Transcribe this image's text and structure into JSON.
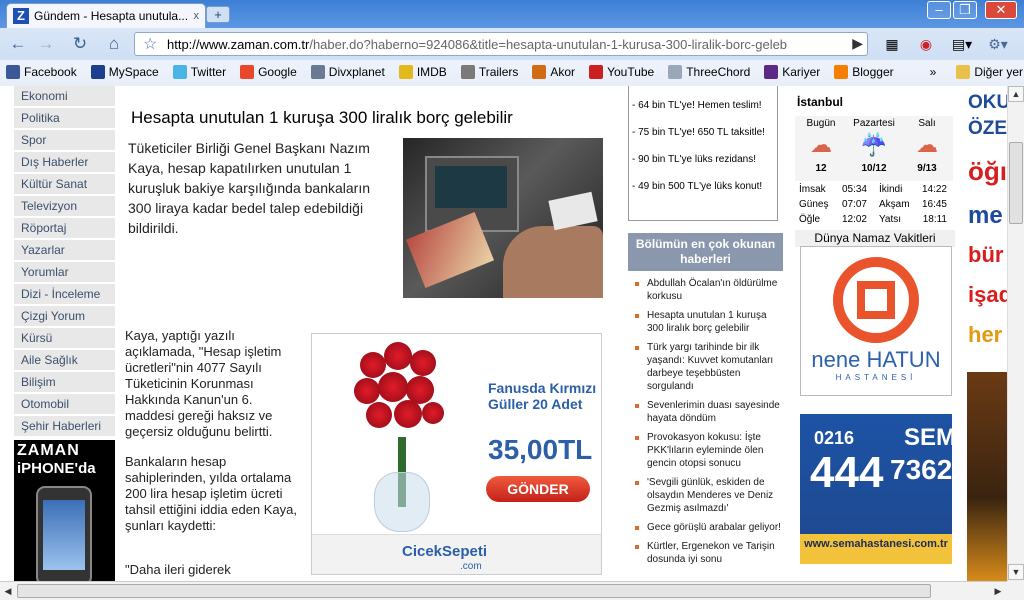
{
  "browser": {
    "tab_title": "Gündem - Hesapta unutula...",
    "tab_close": "x",
    "new_tab": "+",
    "window_controls": [
      "–",
      "❐",
      "✕"
    ],
    "url_host": "http://www.zaman.com.tr",
    "url_path": "/haber.do?haberno=924086&title=hesapta-unutulan-1-kurusa-300-liralik-borc-geleb",
    "bookmarks": [
      {
        "label": "Facebook",
        "icon": "facebook-icon",
        "color": "#3b5998"
      },
      {
        "label": "MySpace",
        "icon": "myspace-icon",
        "color": "#1c3f8f"
      },
      {
        "label": "Twitter",
        "icon": "twitter-icon",
        "color": "#4ab3e8"
      },
      {
        "label": "Google",
        "icon": "google-icon",
        "color": "#e8472b"
      },
      {
        "label": "Divxplanet",
        "icon": "divxplanet-icon",
        "color": "#6a7a93"
      },
      {
        "label": "IMDB",
        "icon": "imdb-icon",
        "color": "#e3b81f"
      },
      {
        "label": "Trailers",
        "icon": "trailers-icon",
        "color": "#7a7a7a"
      },
      {
        "label": "Akor",
        "icon": "akor-icon",
        "color": "#d26b11"
      },
      {
        "label": "YouTube",
        "icon": "youtube-icon",
        "color": "#cc1f1f"
      },
      {
        "label": "ThreeChord",
        "icon": "page-icon",
        "color": "#9aa7b8"
      },
      {
        "label": "Kariyer",
        "icon": "kariyer-icon",
        "color": "#5b2a86"
      },
      {
        "label": "Blogger",
        "icon": "blogger-icon",
        "color": "#f57d00"
      }
    ],
    "bookmarks_overflow": "»",
    "other_bookmarks": "Diğer yer imleri"
  },
  "leftnav": {
    "items": [
      "Ekonomi",
      "Politika",
      "Spor",
      "Dış Haberler",
      "Kültür Sanat",
      "Televizyon",
      "Röportaj",
      "Yazarlar",
      "Yorumlar",
      "Dizi - İnceleme",
      "Çizgi Yorum",
      "Kürsü",
      "Aile Sağlık",
      "Bilişim",
      "Otomobil",
      "Şehir Haberleri"
    ],
    "zaman_ad_logo": "ZAMAN",
    "zaman_ad_text": "iPHONE'da"
  },
  "article": {
    "title": "Hesapta unutulan 1 kuruşa 300 liralık borç gelebilir",
    "lead": "Tüketiciler Birliği Genel Başkanı Nazım Kaya, hesap kapatılırken unutulan 1 kuruşluk bakiye karşılığında bankaların 300 liraya kadar bedel talep edebildiği bildirildi.",
    "para1": "Kaya, yaptığı yazılı açıklamada, \"Hesap işletim ücretleri\"nin 4077 Sayılı Tüketicinin Korunması Hakkında Kanun'un 6. maddesi gereği haksız ve geçersiz olduğunu belirtti.",
    "para2": "Bankaların hesap sahiplerinden, yılda ortalama 200 lira hesap işletim ücreti tahsil ettiğini iddia eden Kaya, şunları kaydetti:",
    "para3": "\"Daha ileri giderek"
  },
  "flower_ad": {
    "headline": "Fanusda Kırmızı Güller 20 Adet",
    "price": "35,00TL",
    "button": "GÖNDER",
    "brand": "CicekSepeti",
    "brand_suffix": ".com"
  },
  "promo": {
    "items": [
      "- 64 bin TL'ye! Hemen teslim!",
      "- 75 bin TL'ye! 650 TL taksitle!",
      "- 90 bin TL'ye lüks rezidans!",
      "- 49 bin 500 TL'ye lüks konut!"
    ]
  },
  "popular": {
    "header": "Bölümün en çok okunan haberleri",
    "items": [
      "Abdullah Öcalan'ın öldürülme korkusu",
      "Hesapta unutulan 1 kuruşa 300 liralık borç gelebilir",
      "Türk yargı tarihinde bir ilk yaşandı: Kuvvet komutanları darbeye teşebbüsten sorgulandı",
      "Sevenlerimin duası sayesinde hayata döndüm",
      "Provokasyon kokusu: İşte PKK'lıların eyleminde ölen gencin otopsi sonucu",
      "'Sevgili günlük, eskiden de olsaydın Menderes ve Deniz Gezmiş asılmazdı'",
      "Gece görüşlü arabalar geliyor!",
      "Kürtler, Ergenekon ve Tarişin dosunda iyi sonu"
    ]
  },
  "weather": {
    "city": "İstanbul",
    "days": [
      {
        "name": "Bugün",
        "temp": "12",
        "icon": "partly-cloudy-icon"
      },
      {
        "name": "Pazartesi",
        "temp": "10/12",
        "icon": "rain-icon"
      },
      {
        "name": "Salı",
        "temp": "9/13",
        "icon": "partly-cloudy-icon"
      }
    ],
    "prayer_left": [
      {
        "name": "İmsak",
        "time": "05:34"
      },
      {
        "name": "Güneş",
        "time": "07:07"
      },
      {
        "name": "Öğle",
        "time": "12:02"
      }
    ],
    "prayer_right": [
      {
        "name": "İkindi",
        "time": "14:22"
      },
      {
        "name": "Akşam",
        "time": "16:45"
      },
      {
        "name": "Yatsı",
        "time": "18:11"
      }
    ],
    "world_title": "Dünya Namaz Vakitleri"
  },
  "ads": {
    "nene_name": "nene HATUN",
    "nene_sub": "HASTANESİ",
    "sema_prefix": "0216",
    "sema_main": "444",
    "sema_name": "SEMA",
    "sema_number": "7362",
    "sema_url": "www.semahastanesi.com.tr",
    "right_texts": [
      "OKUL",
      "ÖZEL K",
      "öğı",
      "me",
      "bür",
      "işad",
      "her"
    ],
    "right_colors": [
      "#1d4a9a",
      "#1d4a9a",
      "#d81e1e",
      "#1d4a9a",
      "#d81e1e",
      "#d81e1e",
      "#e39a12"
    ]
  }
}
